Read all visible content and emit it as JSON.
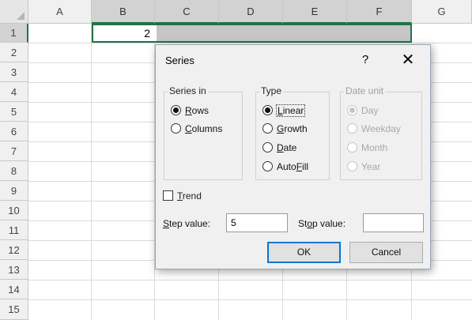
{
  "spreadsheet": {
    "columns": [
      "A",
      "B",
      "C",
      "D",
      "E",
      "F",
      "G"
    ],
    "rows": [
      "1",
      "2",
      "3",
      "4",
      "5",
      "6",
      "7",
      "8",
      "9",
      "10",
      "11",
      "12",
      "13",
      "14",
      "15"
    ],
    "cell_b1_value": "2",
    "selection_color": "#217346"
  },
  "dialog": {
    "title": "Series",
    "help_symbol": "?",
    "close_symbol": "✕",
    "series_in": {
      "label": "Series in",
      "options": [
        {
          "text": "Rows",
          "mnemonic": "R",
          "rest": "ows",
          "selected": true
        },
        {
          "text": "Columns",
          "mnemonic": "C",
          "rest": "olumns",
          "selected": false
        }
      ]
    },
    "type": {
      "label": "Type",
      "options": [
        {
          "text": "Linear",
          "mnemonic": "L",
          "rest": "inear",
          "selected": true
        },
        {
          "text": "Growth",
          "mnemonic": "G",
          "rest": "rowth",
          "selected": false
        },
        {
          "text": "Date",
          "mnemonic": "D",
          "rest": "ate",
          "selected": false
        },
        {
          "text": "AutoFill",
          "pre": "Auto",
          "mnemonic": "F",
          "rest": "ill",
          "selected": false
        }
      ]
    },
    "date_unit": {
      "label": "Date unit",
      "options": [
        {
          "text": "Day",
          "selected": true
        },
        {
          "text": "Weekday",
          "selected": false
        },
        {
          "text": "Month",
          "selected": false
        },
        {
          "text": "Year",
          "selected": false
        }
      ]
    },
    "trend": {
      "mnemonic": "T",
      "rest": "rend",
      "checked": false
    },
    "step_value": {
      "pre": "",
      "mnemonic": "S",
      "rest": "tep value:",
      "value": "5"
    },
    "stop_value": {
      "pre": "St",
      "mnemonic": "o",
      "rest": "p value:",
      "value": ""
    },
    "ok_label": "OK",
    "cancel_label": "Cancel"
  }
}
